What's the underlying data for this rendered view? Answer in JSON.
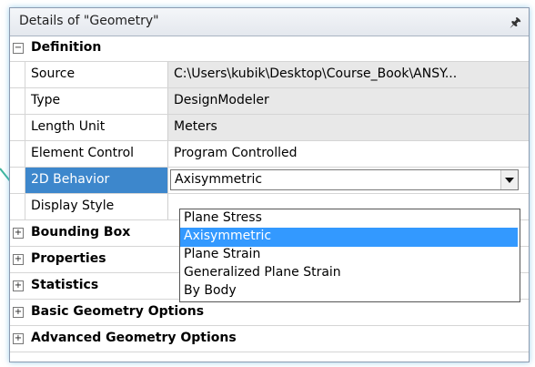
{
  "panel": {
    "title": "Details of \"Geometry\"",
    "pin_icon": "pin-icon"
  },
  "groups": {
    "definition": "Definition",
    "bounding_box": "Bounding Box",
    "properties": "Properties",
    "statistics": "Statistics",
    "basic_geometry_options": "Basic Geometry Options",
    "advanced_geometry_options": "Advanced Geometry Options"
  },
  "expand_symbols": {
    "collapse": "−",
    "expand": "+"
  },
  "rows": [
    {
      "name": "Source",
      "value": "C:\\Users\\kubik\\Desktop\\Course_Book\\ANSY..."
    },
    {
      "name": "Type",
      "value": "DesignModeler"
    },
    {
      "name": "Length Unit",
      "value": "Meters"
    },
    {
      "name": "Element Control",
      "value": "Program Controlled"
    },
    {
      "name": "2D Behavior",
      "value": "Axisymmetric"
    },
    {
      "name": "Display Style",
      "value": ""
    }
  ],
  "dropdown": {
    "selected": "Axisymmetric",
    "options": [
      "Plane Stress",
      "Axisymmetric",
      "Plane Strain",
      "Generalized Plane Strain",
      "By Body"
    ]
  },
  "colors": {
    "selection": "#3d87cc",
    "option_highlight": "#3399ff",
    "readonly_bg": "#e8e8e8"
  }
}
